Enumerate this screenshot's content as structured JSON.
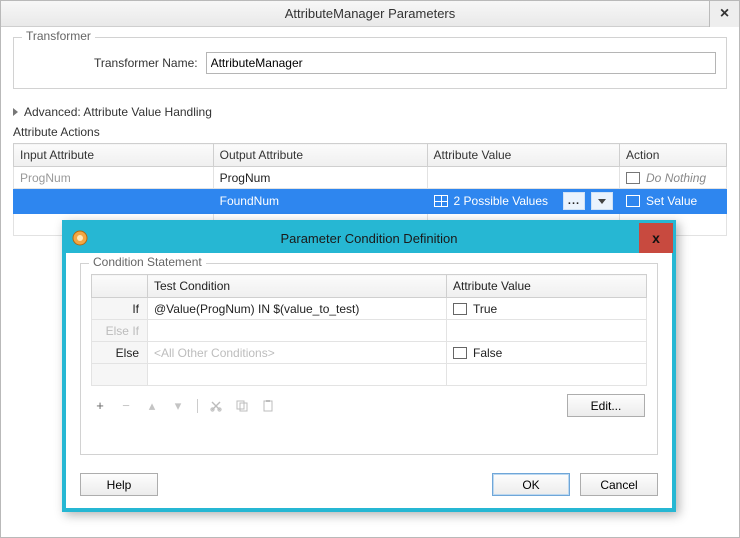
{
  "window": {
    "title": "AttributeManager Parameters",
    "close_label": "×"
  },
  "transformer": {
    "legend": "Transformer",
    "name_label": "Transformer Name:",
    "name_value": "AttributeManager"
  },
  "advanced": {
    "label": "Advanced: Attribute Value Handling"
  },
  "actions": {
    "label": "Attribute Actions",
    "headers": {
      "input": "Input Attribute",
      "output": "Output Attribute",
      "value": "Attribute Value",
      "action": "Action"
    },
    "rows": [
      {
        "input": "ProgNum",
        "output": "ProgNum",
        "value": "",
        "action": "Do Nothing"
      },
      {
        "input": "",
        "output": "FoundNum",
        "value": "2 Possible Values",
        "action": "Set Value"
      }
    ],
    "ellipsis": "...",
    "dropdown": "▼"
  },
  "modal": {
    "title": "Parameter Condition Definition",
    "close_label": "x",
    "legend": "Condition Statement",
    "headers": {
      "kw": "",
      "test": "Test Condition",
      "av": "Attribute Value"
    },
    "rows": [
      {
        "kw": "If",
        "test": "@Value(ProgNum) IN $(value_to_test)",
        "av": "True",
        "dim": false,
        "placeholder": false
      },
      {
        "kw": "Else If",
        "test": "",
        "av": "",
        "dim": true,
        "placeholder": false
      },
      {
        "kw": "Else",
        "test": "<All Other Conditions>",
        "av": "False",
        "dim": false,
        "placeholder": true
      }
    ],
    "toolbar": {
      "add": "+",
      "remove": "−",
      "up": "▴",
      "down": "▾",
      "cut": "✂",
      "copy": "⧉",
      "paste": "📋",
      "edit": "Edit..."
    },
    "buttons": {
      "help": "Help",
      "ok": "OK",
      "cancel": "Cancel"
    }
  }
}
